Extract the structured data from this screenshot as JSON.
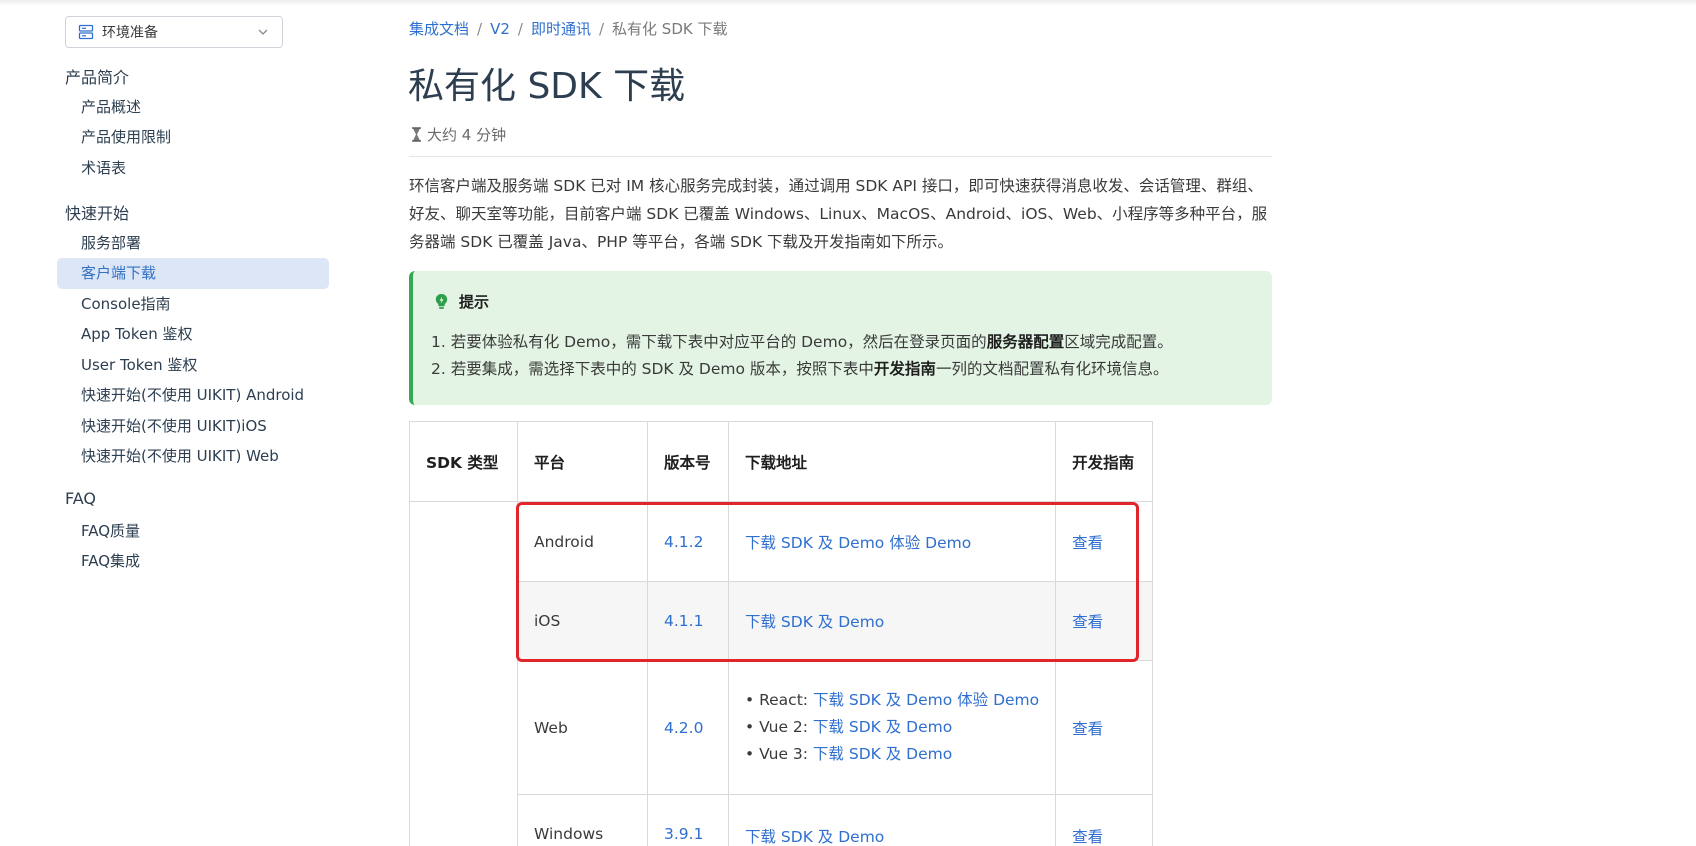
{
  "sidebar": {
    "env_select": {
      "label": "环境准备",
      "icon": "server-icon"
    },
    "sections": [
      {
        "title": "产品简介",
        "items": [
          "产品概述",
          "产品使用限制",
          "术语表"
        ]
      },
      {
        "title": "快速开始",
        "items": [
          "服务部署",
          "客户端下载",
          "Console指南",
          "App Token 鉴权",
          "User Token 鉴权",
          "快速开始(不使用 UIKIT) Android",
          "快速开始(不使用 UIKIT)iOS",
          "快速开始(不使用 UIKIT) Web"
        ]
      },
      {
        "title": "FAQ",
        "items": [
          "FAQ质量",
          "FAQ集成"
        ]
      }
    ],
    "active_item": "客户端下载"
  },
  "breadcrumb": {
    "items": [
      "集成文档",
      "V2",
      "即时通讯"
    ],
    "current": "私有化 SDK 下载",
    "separator": "/"
  },
  "page": {
    "title": "私有化 SDK 下载",
    "read_time": "大约 4 分钟",
    "intro": "环信客户端及服务端 SDK 已对 IM 核心服务完成封装，通过调用 SDK API 接口，即可快速获得消息收发、会话管理、群组、好友、聊天室等功能，目前客户端 SDK 已覆盖 Windows、Linux、MacOS、Android、iOS、Web、小程序等多种平台，服务器端 SDK 已覆盖 Java、PHP 等平台，各端 SDK 下载及开发指南如下所示。"
  },
  "tip": {
    "title": "提示",
    "line1_pre": "1. 若要体验私有化 Demo，需下载下表中对应平台的 Demo，然后在登录页面的",
    "line1_bold": "服务器配置",
    "line1_post": "区域完成配置。",
    "line2_pre": "2. 若要集成，需选择下表中的 SDK 及 Demo 版本，按照下表中",
    "line2_bold": "开发指南",
    "line2_post": "一列的文档配置私有化环境信息。"
  },
  "table": {
    "headers": [
      "SDK 类型",
      "平台",
      "版本号",
      "下载地址",
      "开发指南"
    ],
    "android": {
      "platform": "Android",
      "version": "4.1.2",
      "download": "下载 SDK 及 Demo",
      "demo": "体验 Demo",
      "guide": "查看"
    },
    "ios": {
      "platform": "iOS",
      "version": "4.1.1",
      "download": "下载 SDK 及 Demo",
      "guide": "查看"
    },
    "web": {
      "platform": "Web",
      "version": "4.2.0",
      "guide": "查看",
      "react_label": "• React: ",
      "react_download": "下载 SDK 及 Demo",
      "react_demo": "体验 Demo",
      "vue2_label": "• Vue 2: ",
      "vue2_download": "下载 SDK 及 Demo",
      "vue3_label": "• Vue 3: ",
      "vue3_download": "下载 SDK 及 Demo"
    },
    "windows": {
      "platform": "Windows",
      "version": "3.9.1",
      "download": "下载 SDK 及 Demo",
      "guide": "查看"
    }
  },
  "colors": {
    "link": "#2f6fcf",
    "active_bg": "#dde6f6",
    "tip_bg": "#e3f4e4",
    "tip_border": "#36a852",
    "highlight": "#e0252b"
  }
}
